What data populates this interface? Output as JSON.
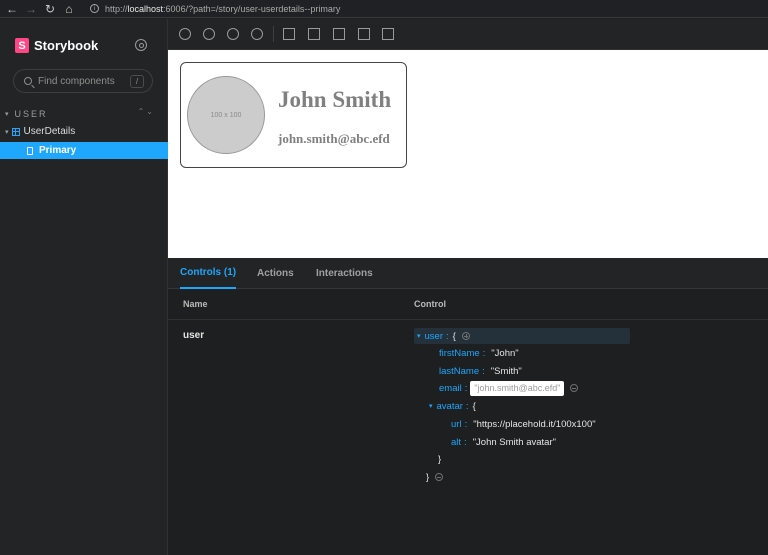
{
  "browser": {
    "url_prefix": "http://",
    "url_host": "localhost",
    "url_rest": ":6006/?path=/story/user-userdetails--primary"
  },
  "sidebar": {
    "brand": "Storybook",
    "search_placeholder": "Find components",
    "search_shortcut": "/",
    "group_label": "USER",
    "component_label": "UserDetails",
    "story_label": "Primary"
  },
  "preview": {
    "name": "John Smith",
    "email": "john.smith@abc.efd",
    "avatar_placeholder": "100 x 100"
  },
  "panel": {
    "tabs": [
      "Controls (1)",
      "Actions",
      "Interactions"
    ],
    "col_name": "Name",
    "col_control": "Control",
    "row_name": "user",
    "json": {
      "root_key": "user",
      "firstName_key": "firstName",
      "firstName_val": "\"John\"",
      "lastName_key": "lastName",
      "lastName_val": "\"Smith\"",
      "email_key": "email",
      "email_val": "\"john.smith@abc.efd\"",
      "avatar_key": "avatar",
      "url_key": "url",
      "url_val": "\"https://placehold.it/100x100\"",
      "alt_key": "alt",
      "alt_val": "\"John Smith avatar\""
    }
  },
  "colors": {
    "accent": "#1ea7fd",
    "brand": "#ff4785"
  }
}
